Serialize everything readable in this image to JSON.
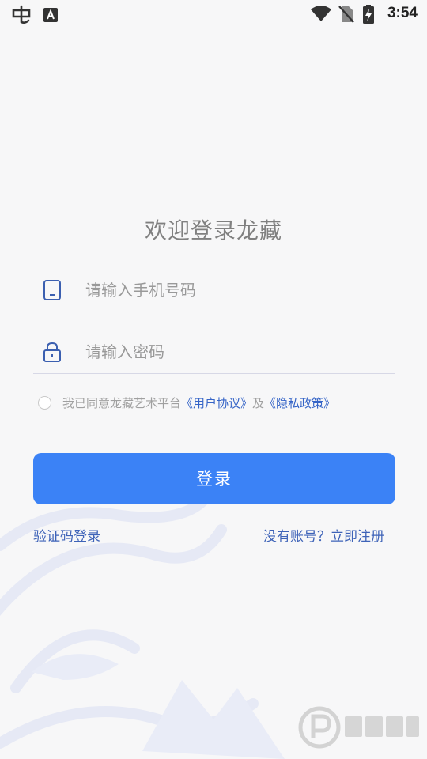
{
  "status_bar": {
    "time": "3:54",
    "left_icons": [
      "app-notification-icon",
      "keyboard-a-icon"
    ],
    "right_icons": [
      "wifi-icon",
      "no-sim-icon",
      "battery-charging-icon"
    ]
  },
  "page": {
    "title": "欢迎登录龙藏"
  },
  "form": {
    "phone_placeholder": "请输入手机号码",
    "password_placeholder": "请输入密码"
  },
  "agreement": {
    "prefix": "我已同意龙藏艺术平台",
    "user_agreement": "《用户协议》",
    "joiner": "及",
    "privacy_policy": "《隐私政策》",
    "checked": false
  },
  "login_button": "登录",
  "links": {
    "sms_login": "验证码登录",
    "register": "没有账号？立即注册"
  },
  "colors": {
    "primary": "#3b82f6",
    "link": "#3e63b8",
    "background": "#f7f7f8"
  }
}
